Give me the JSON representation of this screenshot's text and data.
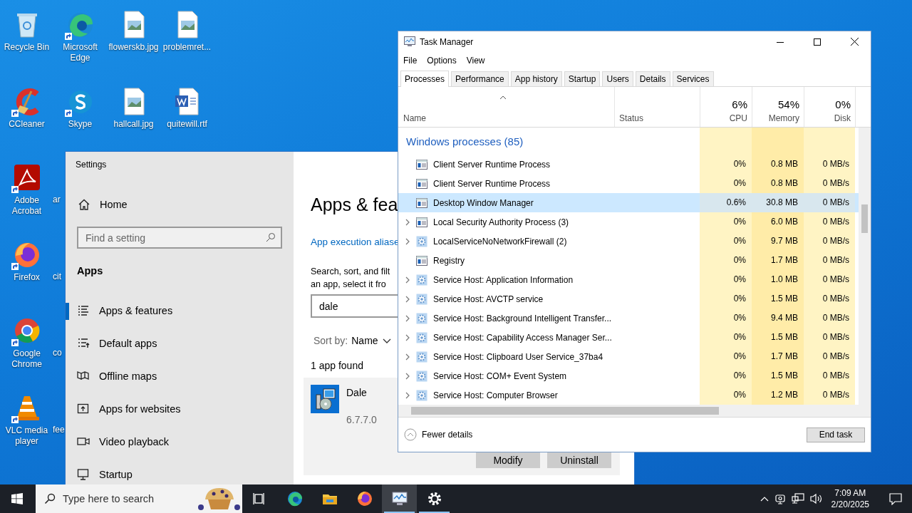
{
  "desktop": {
    "icons": [
      {
        "label": "Recycle Bin",
        "kind": "recycle",
        "shortcut": false
      },
      {
        "label": "Microsoft Edge",
        "kind": "edge",
        "shortcut": true
      },
      {
        "label": "flowerskb.jpg",
        "kind": "image",
        "shortcut": false
      },
      {
        "label": "problemret...",
        "kind": "image",
        "shortcut": false
      },
      {
        "label": "CCleaner",
        "kind": "ccleaner",
        "shortcut": true
      },
      {
        "label": "Skype",
        "kind": "skype",
        "shortcut": true
      },
      {
        "label": "hallcall.jpg",
        "kind": "image",
        "shortcut": false
      },
      {
        "label": "quitewill.rtf",
        "kind": "word",
        "shortcut": false
      },
      {
        "label": "Adobe Acrobat",
        "kind": "acrobat",
        "shortcut": true
      },
      {
        "label": "Firefox",
        "kind": "firefox",
        "shortcut": true
      },
      {
        "label": "Google Chrome",
        "kind": "chrome",
        "shortcut": true
      },
      {
        "label": "VLC media player",
        "kind": "vlc",
        "shortcut": true
      }
    ],
    "covered_labels": [
      "ar",
      "cit",
      "co",
      "fee"
    ]
  },
  "settings": {
    "title": "Settings",
    "home": "Home",
    "search": {
      "placeholder": "Find a setting"
    },
    "section": "Apps",
    "nav": [
      {
        "label": "Apps & features",
        "kind": "list",
        "selected": true
      },
      {
        "label": "Default apps",
        "kind": "defaults",
        "selected": false
      },
      {
        "label": "Offline maps",
        "kind": "map",
        "selected": false
      },
      {
        "label": "Apps for websites",
        "kind": "websites",
        "selected": false
      },
      {
        "label": "Video playback",
        "kind": "video",
        "selected": false
      },
      {
        "label": "Startup",
        "kind": "startup",
        "selected": false
      }
    ],
    "heading": "Apps & fea",
    "link": "App execution aliase",
    "description": [
      "Search, sort, and filt",
      "an app, select it fro"
    ],
    "filter": {
      "value": "dale"
    },
    "sort": {
      "label": "Sort by:",
      "value": "Name"
    },
    "count": "1 app found",
    "app": {
      "name": "Dale",
      "version": "6.7.7.0"
    },
    "buttons": [
      "Modify",
      "Uninstall"
    ]
  },
  "task_manager": {
    "title": "Task Manager",
    "menu": [
      "File",
      "Options",
      "View"
    ],
    "tabs": [
      {
        "label": "Processes",
        "selected": true
      },
      {
        "label": "Performance",
        "selected": false
      },
      {
        "label": "App history",
        "selected": false
      },
      {
        "label": "Startup",
        "selected": false
      },
      {
        "label": "Users",
        "selected": false
      },
      {
        "label": "Details",
        "selected": false
      },
      {
        "label": "Services",
        "selected": false
      }
    ],
    "columns": {
      "name": "Name",
      "status": "Status",
      "cpu": {
        "value": "6%",
        "label": "CPU"
      },
      "memory": {
        "value": "54%",
        "label": "Memory"
      },
      "disk": {
        "value": "0%",
        "label": "Disk"
      }
    },
    "group": "Windows processes (85)",
    "rows": [
      {
        "name": "Client Server Runtime Process",
        "kind": "window",
        "expandable": false,
        "selected": false,
        "cpu": "0%",
        "memory": "0.8 MB",
        "disk": "0 MB/s"
      },
      {
        "name": "Client Server Runtime Process",
        "kind": "window",
        "expandable": false,
        "selected": false,
        "cpu": "0%",
        "memory": "0.8 MB",
        "disk": "0 MB/s"
      },
      {
        "name": "Desktop Window Manager",
        "kind": "window",
        "expandable": false,
        "selected": true,
        "cpu": "0.6%",
        "memory": "30.8 MB",
        "disk": "0 MB/s"
      },
      {
        "name": "Local Security Authority Process (3)",
        "kind": "window",
        "expandable": true,
        "selected": false,
        "cpu": "0%",
        "memory": "6.0 MB",
        "disk": "0 MB/s"
      },
      {
        "name": "LocalServiceNoNetworkFirewall (2)",
        "kind": "gear",
        "expandable": true,
        "selected": false,
        "cpu": "0%",
        "memory": "9.7 MB",
        "disk": "0 MB/s"
      },
      {
        "name": "Registry",
        "kind": "window",
        "expandable": false,
        "selected": false,
        "cpu": "0%",
        "memory": "1.7 MB",
        "disk": "0 MB/s"
      },
      {
        "name": "Service Host: Application Information",
        "kind": "gear",
        "expandable": true,
        "selected": false,
        "cpu": "0%",
        "memory": "1.0 MB",
        "disk": "0 MB/s"
      },
      {
        "name": "Service Host: AVCTP service",
        "kind": "gear",
        "expandable": true,
        "selected": false,
        "cpu": "0%",
        "memory": "1.5 MB",
        "disk": "0 MB/s"
      },
      {
        "name": "Service Host: Background Intelligent Transfer...",
        "kind": "gear",
        "expandable": true,
        "selected": false,
        "cpu": "0%",
        "memory": "9.4 MB",
        "disk": "0 MB/s"
      },
      {
        "name": "Service Host: Capability Access Manager Ser...",
        "kind": "gear",
        "expandable": true,
        "selected": false,
        "cpu": "0%",
        "memory": "1.5 MB",
        "disk": "0 MB/s"
      },
      {
        "name": "Service Host: Clipboard User Service_37ba4",
        "kind": "gear",
        "expandable": true,
        "selected": false,
        "cpu": "0%",
        "memory": "1.7 MB",
        "disk": "0 MB/s"
      },
      {
        "name": "Service Host: COM+ Event System",
        "kind": "gear",
        "expandable": true,
        "selected": false,
        "cpu": "0%",
        "memory": "1.5 MB",
        "disk": "0 MB/s"
      },
      {
        "name": "Service Host: Computer Browser",
        "kind": "gear",
        "expandable": true,
        "selected": false,
        "cpu": "0%",
        "memory": "1.2 MB",
        "disk": "0 MB/s"
      }
    ],
    "fewer_details": "Fewer details",
    "end_task": "End task"
  },
  "taskbar": {
    "search": {
      "placeholder": "Type here to search"
    },
    "apps": [
      {
        "kind": "taskview",
        "active": false,
        "running": false
      },
      {
        "kind": "edge",
        "active": false,
        "running": false
      },
      {
        "kind": "folder",
        "active": false,
        "running": false
      },
      {
        "kind": "firefox",
        "active": false,
        "running": false
      },
      {
        "kind": "taskmanager",
        "active": true,
        "running": true
      },
      {
        "kind": "gear",
        "active": false,
        "running": true
      }
    ],
    "time": "7:09 AM",
    "date": "2/20/2025"
  }
}
